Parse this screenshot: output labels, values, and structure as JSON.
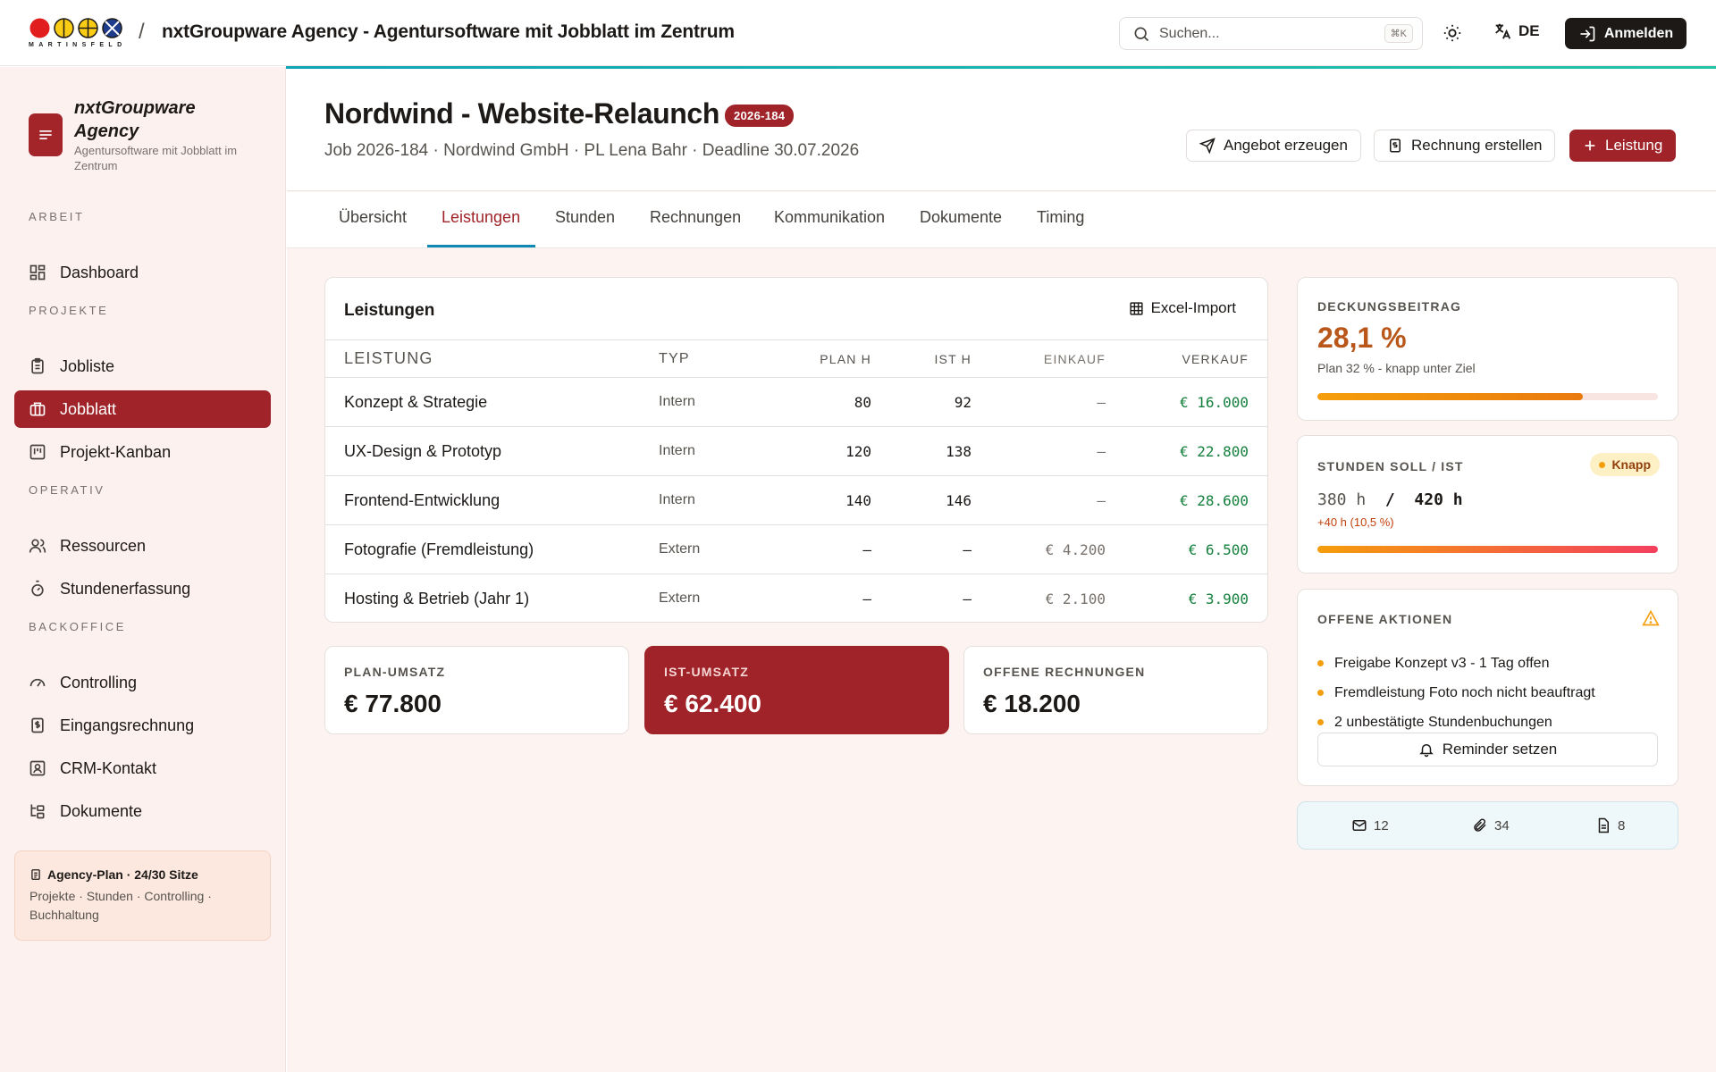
{
  "header": {
    "logo_wordmark": "MARTINSFELD",
    "separator": "/",
    "app_title": "nxtGroupware Agency - Agentursoftware mit Jobblatt im Zentrum",
    "search_placeholder": "Suchen...",
    "search_shortcut": "⌘K",
    "language": "DE",
    "login_label": "Anmelden"
  },
  "sidebar": {
    "brand_name": "nxtGroupware Agency",
    "brand_subtitle": "Agentursoftware mit Jobblatt im Zentrum",
    "sections": [
      {
        "heading": "ARBEIT",
        "items": [
          {
            "label": "Dashboard",
            "icon": "dashboard-icon"
          }
        ]
      },
      {
        "heading": "PROJEKTE",
        "items": [
          {
            "label": "Jobliste",
            "icon": "clipboard-icon"
          },
          {
            "label": "Jobblatt",
            "icon": "briefcase-icon",
            "active": true
          },
          {
            "label": "Projekt-Kanban",
            "icon": "kanban-icon"
          }
        ]
      },
      {
        "heading": "OPERATIV",
        "items": [
          {
            "label": "Ressourcen",
            "icon": "users-icon"
          },
          {
            "label": "Stundenerfassung",
            "icon": "stopwatch-icon"
          }
        ]
      },
      {
        "heading": "BACKOFFICE",
        "items": [
          {
            "label": "Controlling",
            "icon": "gauge-icon"
          },
          {
            "label": "Eingangsrechnung",
            "icon": "receipt-icon"
          },
          {
            "label": "CRM-Kontakt",
            "icon": "contact-icon"
          },
          {
            "label": "Dokumente",
            "icon": "folder-tree-icon"
          }
        ]
      }
    ],
    "plan_title": "Agency-Plan · 24/30 Sitze",
    "plan_features": "Projekte · Stunden · Controlling · Buchhaltung"
  },
  "job": {
    "title": "Nordwind - Website-Relaunch",
    "badge": "2026-184",
    "meta": "Job 2026-184 · Nordwind GmbH · PL Lena Bahr · Deadline 30.07.2026",
    "actions": {
      "offer": "Angebot erzeugen",
      "invoice": "Rechnung erstellen",
      "service": "Leistung"
    }
  },
  "tabs": [
    "Übersicht",
    "Leistungen",
    "Stunden",
    "Rechnungen",
    "Kommunikation",
    "Dokumente",
    "Timing"
  ],
  "active_tab": "Leistungen",
  "services": {
    "title": "Leistungen",
    "import_label": "Excel-Import",
    "columns": [
      "LEISTUNG",
      "TYP",
      "PLAN H",
      "IST H",
      "EINKAUF",
      "VERKAUF"
    ],
    "rows": [
      {
        "name": "Konzept & Strategie",
        "type": "Intern",
        "plan": "80",
        "actual": "92",
        "purchase": "–",
        "sale": "€ 16.000"
      },
      {
        "name": "UX-Design & Prototyp",
        "type": "Intern",
        "plan": "120",
        "actual": "138",
        "purchase": "–",
        "sale": "€ 22.800"
      },
      {
        "name": "Frontend-Entwicklung",
        "type": "Intern",
        "plan": "140",
        "actual": "146",
        "purchase": "–",
        "sale": "€ 28.600"
      },
      {
        "name": "Fotografie (Fremdleistung)",
        "type": "Extern",
        "plan": "–",
        "actual": "–",
        "purchase": "€ 4.200",
        "sale": "€ 6.500"
      },
      {
        "name": "Hosting & Betrieb (Jahr 1)",
        "type": "Extern",
        "plan": "–",
        "actual": "–",
        "purchase": "€ 2.100",
        "sale": "€ 3.900"
      }
    ]
  },
  "kpis": {
    "plan_label": "PLAN-UMSATZ",
    "plan_value": "€ 77.800",
    "actual_label": "IST-UMSATZ",
    "actual_value": "€ 62.400",
    "open_label": "OFFENE RECHNUNGEN",
    "open_value": "€ 18.200"
  },
  "margin": {
    "label": "DECKUNGSBEITRAG",
    "value": "28,1 %",
    "note": "Plan 32 % - knapp unter Ziel",
    "progress": 0.78,
    "bar_colors": [
      "#f59e0b",
      "#ea7a0e"
    ]
  },
  "hours": {
    "label": "STUNDEN SOLL / IST",
    "status": "Knapp",
    "planned": "380 h",
    "separator": "/",
    "actual": "420 h",
    "delta": "+40 h (10,5 %)",
    "progress": 1.0,
    "bar_colors": [
      "#f59e0b",
      "#f43f5e"
    ]
  },
  "open_actions": {
    "label": "OFFENE AKTIONEN",
    "items": [
      "Freigabe Konzept v3 - 1 Tag offen",
      "Fremdleistung Foto noch nicht beauftragt",
      "2 unbestätigte Stundenbuchungen"
    ],
    "reminder_label": "Reminder setzen"
  },
  "stats": {
    "mails": "12",
    "attachments": "34",
    "documents": "8"
  },
  "colors": {
    "brand": "#9f2328",
    "accent": "#0e88b5",
    "positive": "#15803d",
    "warning": "#f59e0b"
  }
}
